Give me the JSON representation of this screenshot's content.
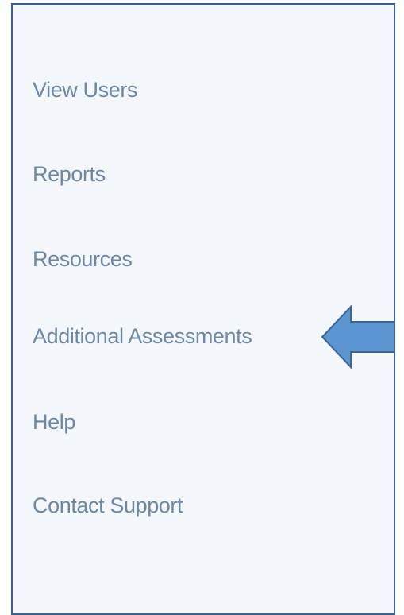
{
  "sidebar": {
    "items": [
      {
        "label": "View Users"
      },
      {
        "label": "Reports"
      },
      {
        "label": "Resources"
      },
      {
        "label": "Additional Assessments"
      },
      {
        "label": "Help"
      },
      {
        "label": "Contact Support"
      }
    ]
  },
  "annotation": {
    "arrow_icon": "left-arrow-icon",
    "arrow_color": "#5b96d2",
    "arrow_border": "#3d6691"
  },
  "colors": {
    "link_text": "#6c87a8",
    "panel_background": "#f4f7fb",
    "panel_border": "#3a5f91"
  }
}
